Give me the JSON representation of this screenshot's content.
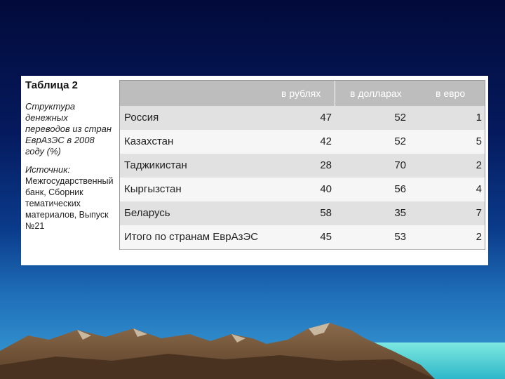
{
  "side": {
    "title": "Таблица 2",
    "desc": "Структура денежных переводов из стран ЕврАзЭС в 2008 году (%)",
    "source_label": "Источник:",
    "source_text": "Межгосударственный банк, Сборник тематических материалов, Выпуск №21"
  },
  "table": {
    "headers": [
      "в рублях",
      "в долларах",
      "в евро"
    ],
    "rows": [
      {
        "name": "Россия",
        "rub": "47",
        "usd": "52",
        "eur": "1"
      },
      {
        "name": "Казахстан",
        "rub": "42",
        "usd": "52",
        "eur": "5"
      },
      {
        "name": "Таджикистан",
        "rub": "28",
        "usd": "70",
        "eur": "2"
      },
      {
        "name": "Кыргызстан",
        "rub": "40",
        "usd": "56",
        "eur": "4"
      },
      {
        "name": "Беларусь",
        "rub": "58",
        "usd": "35",
        "eur": "7"
      },
      {
        "name": "Итого по странам ЕврАзЭС",
        "rub": "45",
        "usd": "53",
        "eur": "2"
      }
    ]
  },
  "colors": {
    "header_bg": "#bdbdbd",
    "row_alt": "#e1e1e1",
    "row_plain": "#f6f6f6"
  }
}
